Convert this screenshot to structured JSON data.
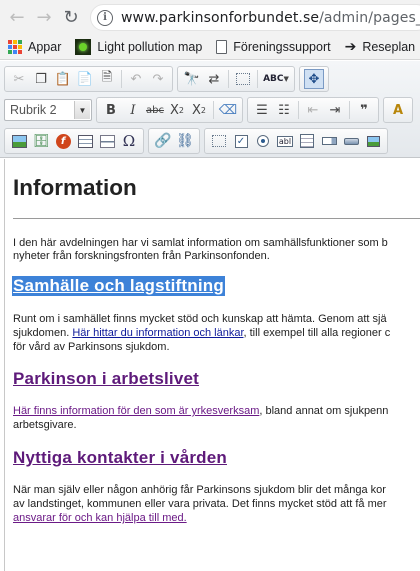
{
  "browser": {
    "url_host": "www.parkinsonforbundet.se",
    "url_path": "/admin/pages_edit.ph",
    "bookmarks": [
      {
        "label": "Appar",
        "icon": "apps-grid-icon"
      },
      {
        "label": "Light pollution map",
        "icon": "light-pollution-icon"
      },
      {
        "label": "Föreningssupport",
        "icon": "page-icon"
      },
      {
        "label": "Reseplan",
        "icon": "arrow-icon"
      }
    ]
  },
  "toolbar": {
    "format_combo": "Rubrik 2",
    "bold": "B",
    "italic": "I",
    "strike": "abc",
    "subscript": "X",
    "superscript": "X",
    "spell": "ABC",
    "omega": "Ω"
  },
  "content": {
    "title": "Information",
    "intro_line1": "I den här avdelningen har vi samlat information om samhällsfunktioner som b",
    "intro_line2": "nyheter från forskningsfronten från Parkinsonfonden.",
    "h_samhalle": "Samhälle och lagstiftning",
    "samhalle_line1": "Runt om i samhället finns mycket stöd och kunskap att hämta. Genom att sjä",
    "samhalle_line2_pre": "sjukdomen. ",
    "samhalle_link": "Här hittar du information och länkar",
    "samhalle_line2_post": ", till exempel till alla regioner c",
    "samhalle_line3": "för vård av Parkinsons sjukdom.",
    "h_arbetslivet": "Parkinson i arbetslivet",
    "arbetslivet_link": "Här finns information för den som är yrkesverksam",
    "arbetslivet_line1_post": ", bland annat om sjukpenn",
    "arbetslivet_line2": "arbetsgivare.",
    "h_kontakter": "Nyttiga kontakter i vården",
    "kontakter_line1": "När man själv eller någon anhörig får Parkinsons sjukdom blir det många kor",
    "kontakter_line2": "av landstinget, kommunen eller vara privata. Det finns mycket stöd att få mer",
    "kontakter_link": "ansvarar för och kan hjälpa till med."
  }
}
